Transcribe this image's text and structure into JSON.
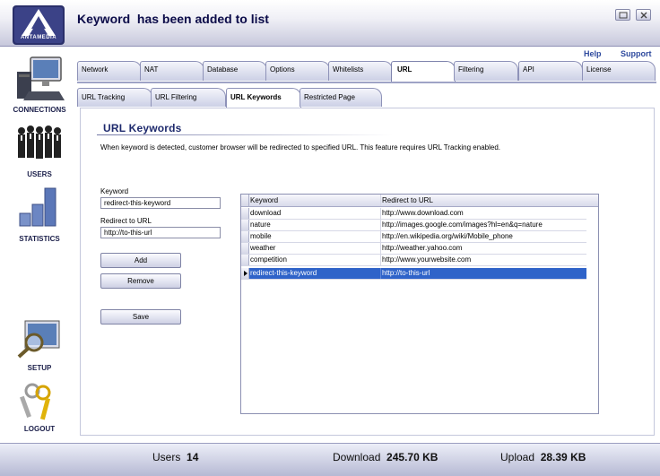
{
  "header": {
    "brand": "ANTAMEDIA",
    "title": "Keyword  has been added to list"
  },
  "sidebar": {
    "items": [
      {
        "label": "CONNECTIONS",
        "icon": "computer-icon"
      },
      {
        "label": "USERS",
        "icon": "users-group-icon"
      },
      {
        "label": "STATISTICS",
        "icon": "bar-chart-icon"
      },
      {
        "label": "SETUP",
        "icon": "setup-magnifier-icon"
      },
      {
        "label": "LOGOUT",
        "icon": "keys-icon"
      }
    ]
  },
  "toplinks": {
    "help": "Help",
    "support": "Support"
  },
  "tabs": [
    {
      "label": "Network"
    },
    {
      "label": "NAT"
    },
    {
      "label": "Database"
    },
    {
      "label": "Options"
    },
    {
      "label": "Whitelists"
    },
    {
      "label": "URL",
      "active": true
    },
    {
      "label": "Filtering"
    },
    {
      "label": "API"
    },
    {
      "label": "License"
    }
  ],
  "subtabs": [
    {
      "label": "URL Tracking"
    },
    {
      "label": "URL Filtering"
    },
    {
      "label": "URL Keywords",
      "active": true
    },
    {
      "label": "Restricted Page"
    }
  ],
  "section": {
    "title": "URL Keywords",
    "description": "When keyword is detected, customer browser will be redirected to specified URL. This feature requires URL Tracking enabled."
  },
  "form": {
    "keyword_label": "Keyword",
    "keyword_value": "redirect-this-keyword",
    "redirect_label": "Redirect to URL",
    "redirect_value": "http://to-this-url",
    "add": "Add",
    "remove": "Remove",
    "save": "Save"
  },
  "grid": {
    "columns": [
      "Keyword",
      "Redirect to URL"
    ],
    "rows": [
      {
        "keyword": "download",
        "url": "http://www.download.com"
      },
      {
        "keyword": "nature",
        "url": "http://images.google.com/images?hl=en&q=nature"
      },
      {
        "keyword": "mobile",
        "url": "http://en.wikipedia.org/wiki/Mobile_phone"
      },
      {
        "keyword": "weather",
        "url": "http://weather.yahoo.com"
      },
      {
        "keyword": "competition",
        "url": "http://www.yourwebsite.com"
      },
      {
        "keyword": "redirect-this-keyword",
        "url": "http://to-this-url",
        "selected": true
      }
    ]
  },
  "footer": {
    "users_label": "Users",
    "users_value": "14",
    "download_label": "Download",
    "download_value": "245.70 KB",
    "upload_label": "Upload",
    "upload_value": "28.39 KB"
  },
  "colors": {
    "accent": "#2f63c9",
    "title": "#0d0d4a",
    "links": "#2e4a9e"
  }
}
